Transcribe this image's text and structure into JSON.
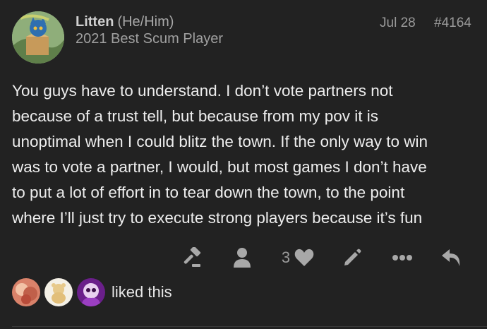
{
  "post": {
    "user": {
      "name": "Litten",
      "pronouns": "(He/Him)",
      "title": "2021 Best Scum Player"
    },
    "date": "Jul 28",
    "post_number": "#4164",
    "body_lines": [
      "You guys have to understand. I don’t vote partners not",
      "because of a trust tell, but because from my pov it is",
      "unoptimal when I could blitz the town. If the only way to win",
      "was to vote a partner, I would, but most games I don’t have",
      "to put a lot of effort in to tear down the town, to the point",
      "where I’ll just try to execute strong players because it’s fun"
    ],
    "like_count": "3",
    "liked_text": "liked this"
  },
  "icons": [
    "gavel-icon",
    "user-icon",
    "heart-icon",
    "pencil-icon",
    "ellipsis-icon",
    "reply-icon"
  ],
  "colors": {
    "background": "#222222",
    "text": "#ededed",
    "muted": "#9a9a9a",
    "icon": "#a8a8a8"
  }
}
